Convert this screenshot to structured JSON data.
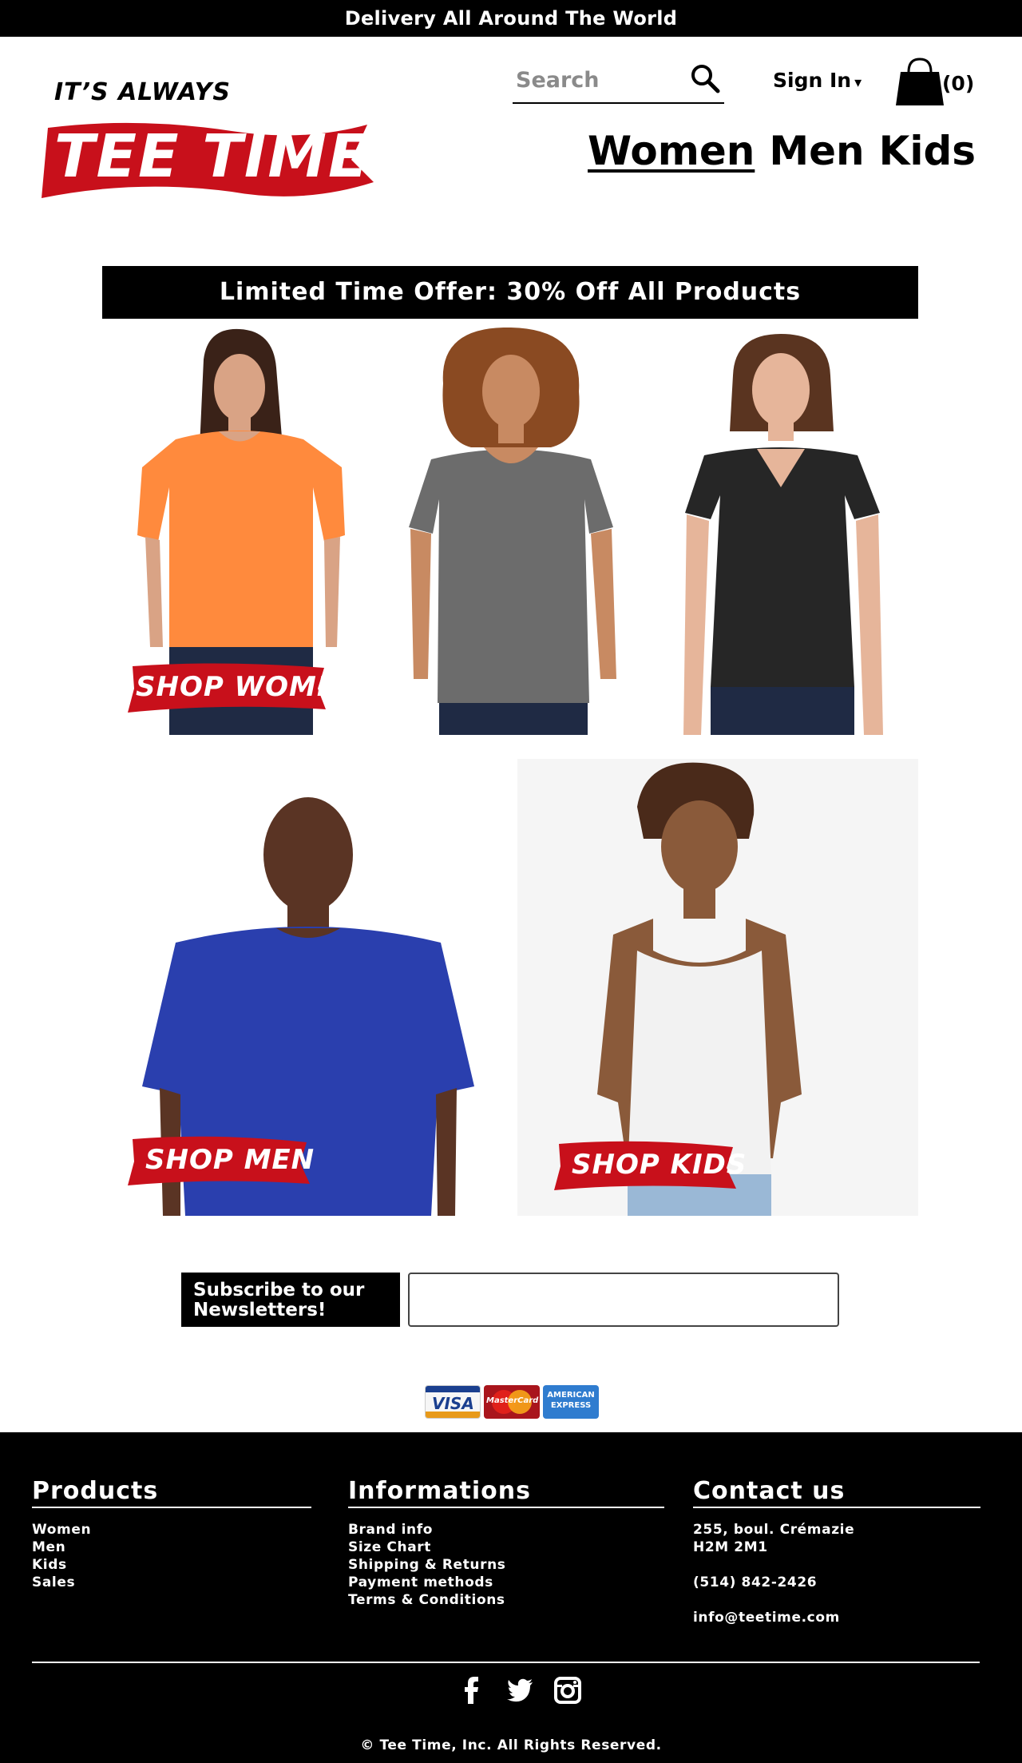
{
  "topbar": {
    "text": "Delivery All Around The World"
  },
  "logo": {
    "small": "IT’S ALWAYS",
    "big": "TEE TIME"
  },
  "search": {
    "placeholder": "Search"
  },
  "account": {
    "signin": "Sign In",
    "caret": "▾",
    "cart_count": "(0)"
  },
  "nav": {
    "women": "Women",
    "men": "Men",
    "kids": "Kids",
    "active": "Women"
  },
  "promo": {
    "text": "Limited Time Offer: 30% Off All Products"
  },
  "tiles": {
    "women": {
      "badge": "SHOP WOMEN"
    },
    "men": {
      "badge": "SHOP MEN"
    },
    "kids": {
      "badge": "SHOP KIDS"
    }
  },
  "newsletter": {
    "label_line1": "Subscribe to our",
    "label_line2": "Newsletters!",
    "value": ""
  },
  "payment": {
    "cards": [
      "VISA",
      "MasterCard",
      "AMERICAN EXPRESS"
    ]
  },
  "footer": {
    "products": {
      "title": "Products",
      "items": [
        "Women",
        "Men",
        "Kids",
        "Sales"
      ]
    },
    "informations": {
      "title": "Informations",
      "items": [
        "Brand info",
        "Size Chart",
        "Shipping & Returns",
        "Payment methods",
        "Terms & Conditions"
      ]
    },
    "contact": {
      "title": "Contact us",
      "address1": "255, boul. Crémazie",
      "address2": "H2M 2M1",
      "phone": "(514) 842-2426",
      "email": "info@teetime.com"
    },
    "social": [
      "facebook-icon",
      "twitter-icon",
      "instagram-icon"
    ],
    "copyright": "© Tee Time, Inc. All Rights Reserved."
  },
  "colors": {
    "brand_red": "#c8101b",
    "black": "#000000",
    "shirt_orange": "#ff8a3d",
    "shirt_grey": "#6c6c6c",
    "shirt_black": "#262626",
    "shirt_blue": "#2a3fae",
    "shirt_white": "#f2f2f2"
  }
}
